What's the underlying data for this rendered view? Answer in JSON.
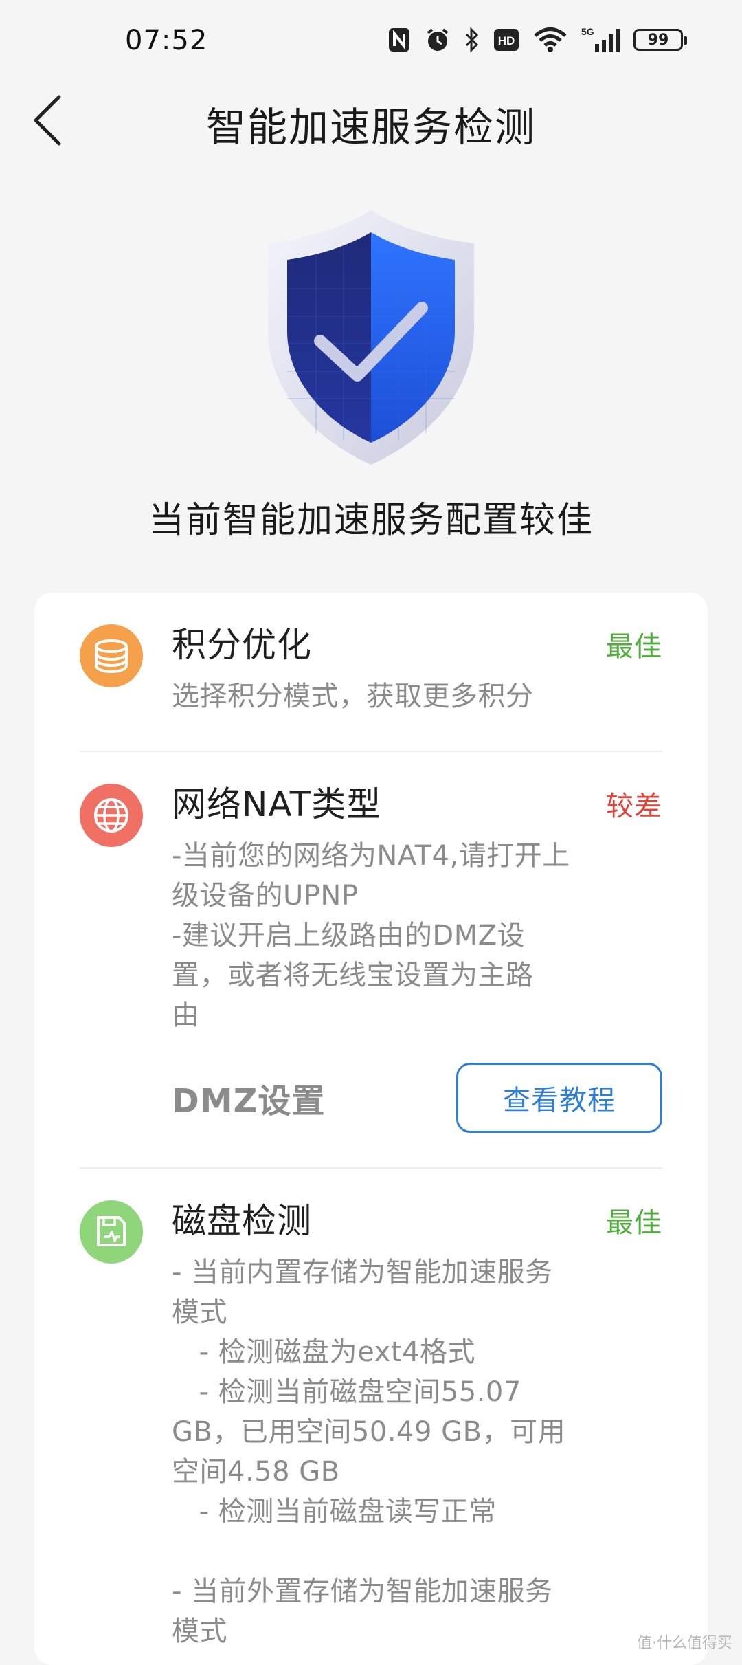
{
  "status_bar": {
    "time": "07:52",
    "icons": [
      "nfc-icon",
      "alarm-icon",
      "bluetooth-icon",
      "hd-icon",
      "wifi-icon",
      "signal-5g-icon"
    ],
    "hd_label": "HD",
    "network_label": "5G",
    "battery": "99"
  },
  "header": {
    "back_icon": "chevron-left-icon",
    "title": "智能加速服务检测"
  },
  "hero": {
    "icon": "shield-check-icon",
    "text": "当前智能加速服务配置较佳"
  },
  "sections": [
    {
      "icon": "coins-icon",
      "icon_color": "#f5a04a",
      "title": "积分优化",
      "status": "最佳",
      "status_color": "#4fae3a",
      "description": "选择积分模式，获取更多积分"
    },
    {
      "icon": "globe-icon",
      "icon_color": "#f07064",
      "title": "网络NAT类型",
      "status": "较差",
      "status_color": "#e0453a",
      "description": "-当前您的网络为NAT4,请打开上\n级设备的UPNP\n-建议开启上级路由的DMZ设\n置，或者将无线宝设置为主路\n由",
      "action_label": "DMZ设置",
      "action_button": "查看教程"
    },
    {
      "icon": "disk-check-icon",
      "icon_color": "#8fd67a",
      "title": "磁盘检测",
      "status": "最佳",
      "status_color": "#4fae3a",
      "description": "- 当前内置存储为智能加速服务\n模式\n   - 检测磁盘为ext4格式\n   - 检测当前磁盘空间55.07\nGB，已用空间50.49 GB，可用\n空间4.58 GB\n   - 检测当前磁盘读写正常\n\n- 当前外置存储为智能加速服务\n模式"
    }
  ],
  "watermark": "值·什么值得买",
  "colors": {
    "background": "#f5f5f5",
    "card": "#ffffff",
    "accent_blue": "#2f7fd8",
    "good": "#4fae3a",
    "bad": "#e0453a"
  }
}
